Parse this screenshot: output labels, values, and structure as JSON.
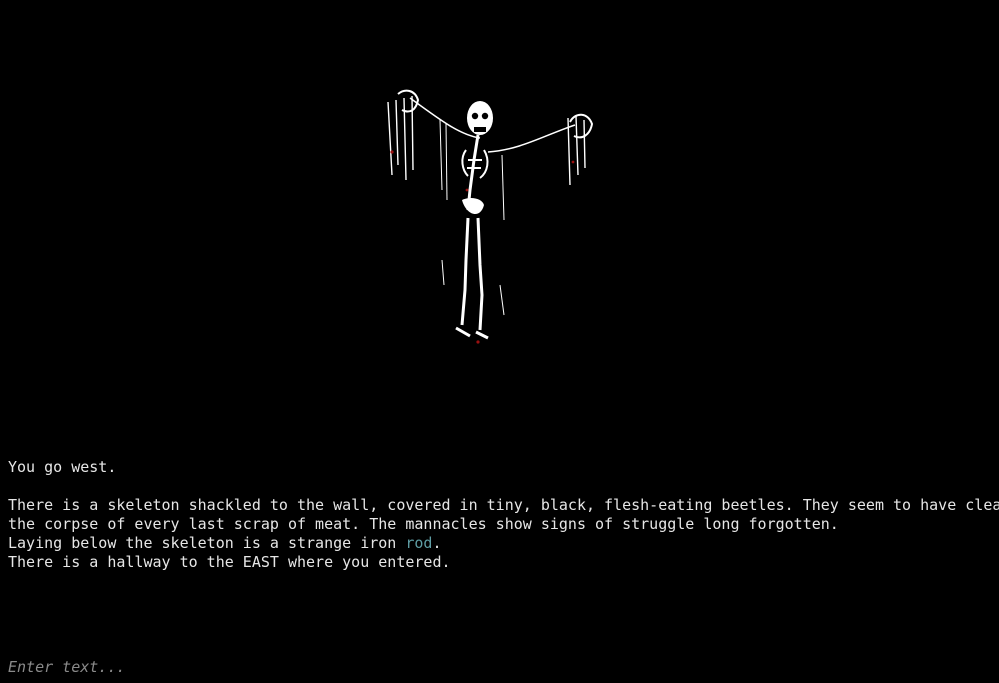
{
  "scene": {
    "image_subject": "shackled-skeleton"
  },
  "narration": {
    "line1": "You go west.",
    "line2": "There is a skeleton shackled to the wall, covered in tiny, black, flesh-eating beetles. They seem to have cleaned",
    "line3": "the corpse of every last scrap of meat. The mannacles show signs of struggle long forgotten.",
    "line4_prefix": "Laying below the skeleton is a strange iron ",
    "line4_keyword": "rod",
    "line4_suffix": ".",
    "line5": "There is a hallway to the EAST where you entered."
  },
  "input": {
    "placeholder": "Enter text..."
  },
  "colors": {
    "background": "#000000",
    "text": "#e6e6e6",
    "keyword": "#5f9ea5",
    "placeholder": "#8a8a8a"
  }
}
